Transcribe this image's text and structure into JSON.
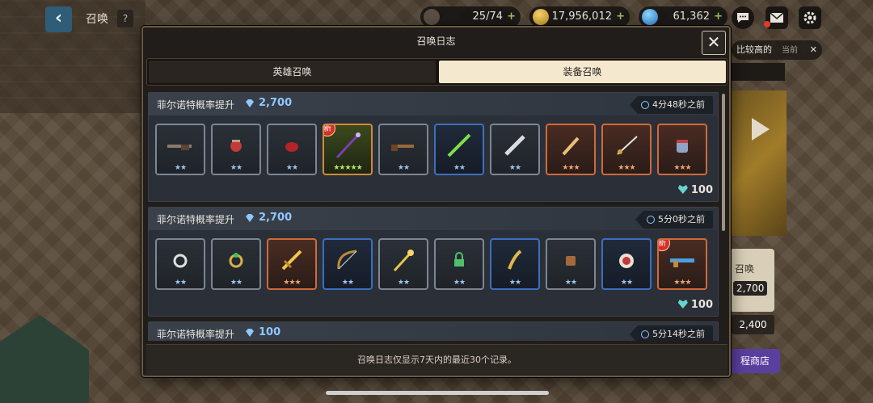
{
  "topbar": {
    "title": "召唤",
    "help": "?",
    "back_glyph": "‹",
    "resources": {
      "stamina": "25/74",
      "gold": "17,956,012",
      "gems": "61,362",
      "plus": "+"
    }
  },
  "background": {
    "high_label": "比较高的",
    "high_sub": "当前",
    "high_close": "✕",
    "card_label": "召唤",
    "card_price": "2,700",
    "price2": "2,400",
    "shop_label": "程商店"
  },
  "modal": {
    "title": "召唤日志",
    "close_glyph": "✕",
    "tabs": [
      {
        "label": "英雄召唤",
        "active": false
      },
      {
        "label": "装备召唤",
        "active": true
      }
    ],
    "entries": [
      {
        "title": "菲尔诺特概率提升",
        "cost": "2,700",
        "time": "4分48秒之前",
        "footer": "100",
        "items": [
          {
            "name": "rifle",
            "stars": "★★",
            "rarity": "r2",
            "new": false
          },
          {
            "name": "red-orb",
            "stars": "★★",
            "rarity": "r2",
            "new": false
          },
          {
            "name": "red-gem",
            "stars": "★★",
            "rarity": "r2",
            "new": false
          },
          {
            "name": "purple-staff",
            "stars": "★★★★★",
            "rarity": "r5",
            "new": true,
            "new_label": "新"
          },
          {
            "name": "musket",
            "stars": "★★",
            "rarity": "r2",
            "new": false
          },
          {
            "name": "green-sword",
            "stars": "★★",
            "rarity": "blue",
            "new": false
          },
          {
            "name": "white-blade",
            "stars": "★★",
            "rarity": "r2",
            "new": false
          },
          {
            "name": "dagger",
            "stars": "★★★",
            "rarity": "r3",
            "new": false
          },
          {
            "name": "rapier",
            "stars": "★★★",
            "rarity": "r3",
            "new": false
          },
          {
            "name": "gauntlet",
            "stars": "★★★",
            "rarity": "r3",
            "new": false
          }
        ]
      },
      {
        "title": "菲尔诺特概率提升",
        "cost": "2,700",
        "time": "5分0秒之前",
        "footer": "100",
        "items": [
          {
            "name": "silver-ring",
            "stars": "★★",
            "rarity": "r2",
            "new": false
          },
          {
            "name": "gold-ring",
            "stars": "★★",
            "rarity": "r2",
            "new": false
          },
          {
            "name": "golden-sword",
            "stars": "★★★",
            "rarity": "r3",
            "new": false
          },
          {
            "name": "bow",
            "stars": "★★",
            "rarity": "blue",
            "new": false
          },
          {
            "name": "scepter",
            "stars": "★★",
            "rarity": "r2",
            "new": false
          },
          {
            "name": "lock-charm",
            "stars": "★★",
            "rarity": "r2",
            "new": false
          },
          {
            "name": "feather-emblem",
            "stars": "★★",
            "rarity": "blue",
            "new": false
          },
          {
            "name": "bracer",
            "stars": "★★",
            "rarity": "r2",
            "new": false
          },
          {
            "name": "round-shield",
            "stars": "★★",
            "rarity": "blue",
            "new": false
          },
          {
            "name": "blue-gun",
            "stars": "★★★",
            "rarity": "r3",
            "new": true,
            "new_label": "新"
          }
        ]
      },
      {
        "title": "菲尔诺特概率提升",
        "cost": "100",
        "time": "5分14秒之前"
      }
    ],
    "notice": "召唤日志仅显示7天内的最近30个记录。"
  },
  "colors": {
    "accent_gem": "#8fc7ff",
    "tab_active_bg": "#f4e8cf",
    "rarity_3": "#d06a3a",
    "rarity_blue": "#3b6fbf",
    "new_badge": "#d62f2a"
  }
}
